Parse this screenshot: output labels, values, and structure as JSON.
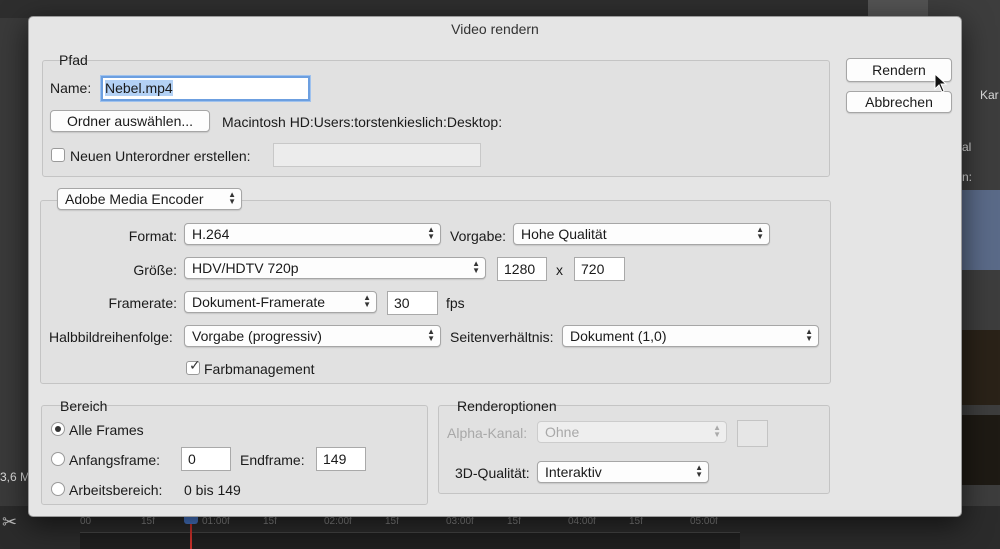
{
  "dialog": {
    "title": "Video rendern",
    "render_button": "Rendern",
    "cancel_button": "Abbrechen"
  },
  "pfad": {
    "legend": "Pfad",
    "name_label": "Name:",
    "name_value": "Nebel.mp4",
    "choose_folder_button": "Ordner auswählen...",
    "folder_path": "Macintosh HD:Users:torstenkieslich:Desktop:",
    "subfolder_label": "Neuen Unterordner erstellen:",
    "subfolder_checked": false,
    "subfolder_value": ""
  },
  "encoder": {
    "selected": "Adobe Media Encoder",
    "format_label": "Format:",
    "format_value": "H.264",
    "preset_label": "Vorgabe:",
    "preset_value": "Hohe Qualität",
    "size_label": "Größe:",
    "size_value": "HDV/HDTV 720p",
    "width": "1280",
    "x_sep": "x",
    "height": "720",
    "framerate_label": "Framerate:",
    "framerate_value": "Dokument-Framerate",
    "fps_value": "30",
    "fps_unit": "fps",
    "field_order_label": "Halbbildreihenfolge:",
    "field_order_value": "Vorgabe (progressiv)",
    "aspect_label": "Seitenverhältnis:",
    "aspect_value": "Dokument (1,0)",
    "color_mgmt_label": "Farbmanagement",
    "color_mgmt_checked": true
  },
  "bereich": {
    "legend": "Bereich",
    "all_frames": "Alle Frames",
    "start_frame_label": "Anfangsframe:",
    "start_frame_value": "0",
    "end_frame_label": "Endframe:",
    "end_frame_value": "149",
    "work_area_label": "Arbeitsbereich:",
    "work_area_value": "0 bis 149",
    "selected": "Alle Frames"
  },
  "renderoptionen": {
    "legend": "Renderoptionen",
    "alpha_label": "Alpha-Kanal:",
    "alpha_value": "Ohne",
    "quality_label": "3D-Qualität:",
    "quality_value": "Interaktiv"
  },
  "background": {
    "panel_tab_1": "n",
    "panel_tab_2": "Kar",
    "panel_text_1": "al",
    "panel_text_2": "n:",
    "status_zoom": "3,6 M",
    "timeline_ticks": [
      "00",
      "15f",
      "01:00f",
      "15f",
      "02:00f",
      "15f",
      "03:00f",
      "15f",
      "04:00f",
      "15f",
      "05:00f"
    ]
  },
  "colors": {
    "dialog_bg": "#e5e5e5",
    "focus_ring": "#6c9fe0",
    "selection": "#b3d1f5",
    "playhead": "#c8302a"
  }
}
